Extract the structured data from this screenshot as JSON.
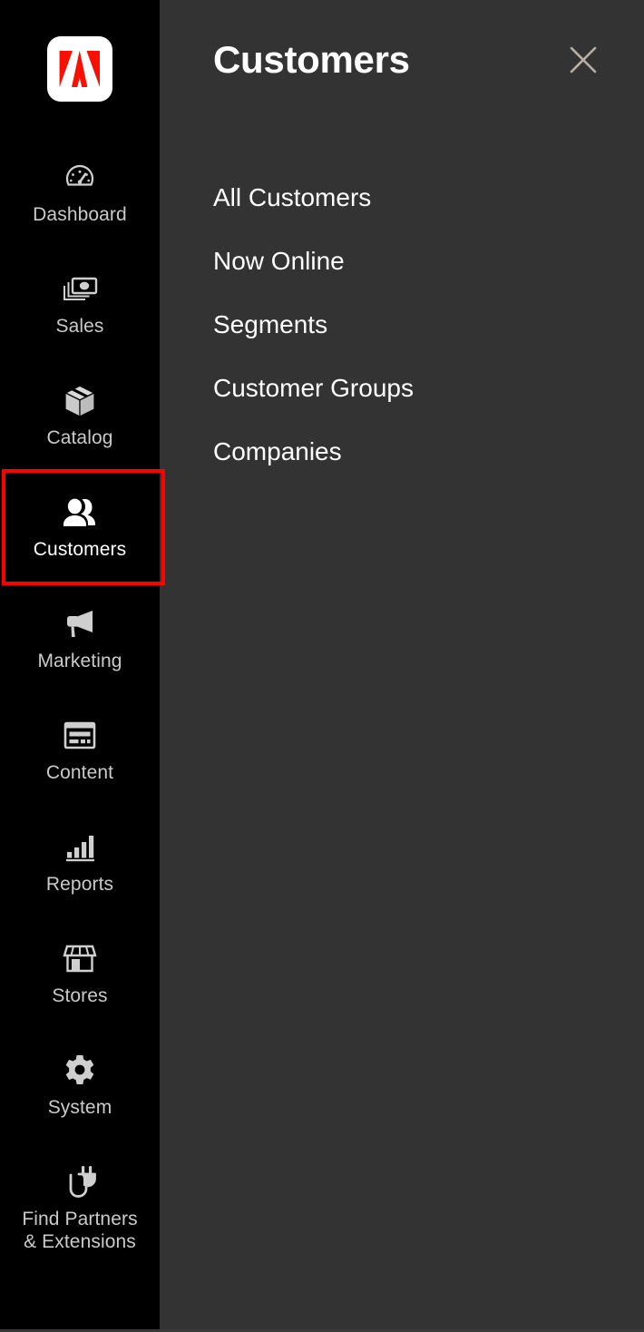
{
  "colors": {
    "sidebar_bg": "#000000",
    "panel_bg": "#333333",
    "selection_outline": "#ff0000",
    "label": "#cacaca",
    "label_active": "#ffffff",
    "logo_red": "#fa0f00",
    "close_icon": "#b8b0a6"
  },
  "sidebar": {
    "logo": {
      "name": "adobe-commerce-logo",
      "icon": "adobe-a-logo"
    },
    "items": [
      {
        "label": "Dashboard",
        "icon": "dashboard-gauge-icon",
        "selected": false
      },
      {
        "label": "Sales",
        "icon": "sales-money-icon",
        "selected": false
      },
      {
        "label": "Catalog",
        "icon": "catalog-box-icon",
        "selected": false
      },
      {
        "label": "Customers",
        "icon": "customers-people-icon",
        "selected": true
      },
      {
        "label": "Marketing",
        "icon": "marketing-megaphone-icon",
        "selected": false
      },
      {
        "label": "Content",
        "icon": "content-layout-icon",
        "selected": false
      },
      {
        "label": "Reports",
        "icon": "reports-bar-chart-icon",
        "selected": false
      },
      {
        "label": "Stores",
        "icon": "stores-storefront-icon",
        "selected": false
      },
      {
        "label": "System",
        "icon": "system-gear-icon",
        "selected": false
      },
      {
        "label": "Find Partners\n& Extensions",
        "icon": "plug-icon",
        "selected": false
      }
    ]
  },
  "panel": {
    "title": "Customers",
    "close_label": "close-icon",
    "menu_items": [
      {
        "label": "All Customers"
      },
      {
        "label": "Now Online"
      },
      {
        "label": "Segments"
      },
      {
        "label": "Customer Groups"
      },
      {
        "label": "Companies"
      }
    ]
  }
}
